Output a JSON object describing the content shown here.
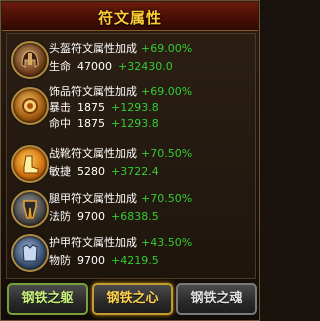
{
  "window": {
    "title": "符文属性"
  },
  "runes": [
    {
      "icon": "helmet-icon",
      "header": "头盔符文属性加成",
      "percent": "+69.00%",
      "stats": [
        {
          "name": "生命",
          "value": "47000",
          "bonus": "+32430.0"
        }
      ]
    },
    {
      "icon": "amulet-icon",
      "header": "饰品符文属性加成",
      "percent": "+69.00%",
      "stats": [
        {
          "name": "暴击",
          "value": "1875",
          "bonus": "+1293.8"
        },
        {
          "name": "命中",
          "value": "1875",
          "bonus": "+1293.8"
        }
      ]
    },
    {
      "icon": "boots-icon",
      "header": "战靴符文属性加成",
      "percent": "+70.50%",
      "stats": [
        {
          "name": "敏捷",
          "value": "5280",
          "bonus": "+3722.4"
        }
      ]
    },
    {
      "icon": "leggings-icon",
      "header": "腿甲符文属性加成",
      "percent": "+70.50%",
      "stats": [
        {
          "name": "法防",
          "value": "9700",
          "bonus": "+6838.5"
        }
      ]
    },
    {
      "icon": "armor-icon",
      "header": "护甲符文属性加成",
      "percent": "+43.50%",
      "stats": [
        {
          "name": "物防",
          "value": "9700",
          "bonus": "+4219.5"
        }
      ]
    }
  ],
  "buttons": {
    "left": "钢铁之躯",
    "middle": "钢铁之心",
    "right": "钢铁之魂"
  },
  "colors": {
    "title": "#ffcc33",
    "bonus": "#33cc33",
    "text": "#ffffff"
  }
}
